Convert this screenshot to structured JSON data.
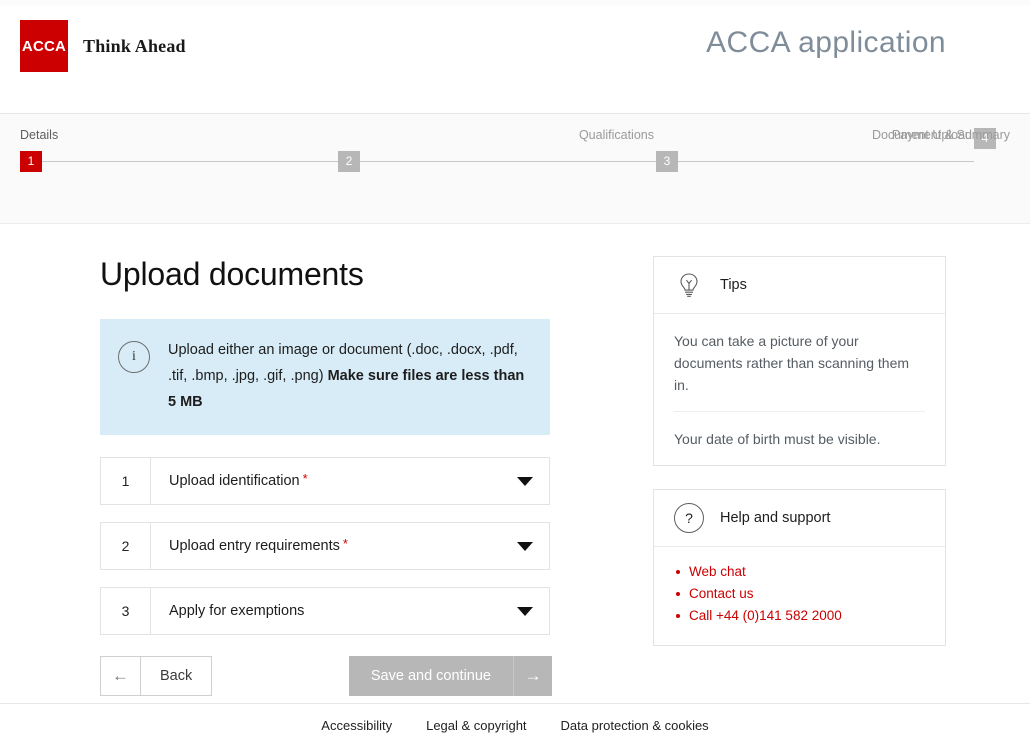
{
  "header": {
    "logo_text": "ACCA",
    "tagline": "Think Ahead",
    "app_title": "ACCA application",
    "brand_red": "#CC0000"
  },
  "stepper": {
    "steps": [
      {
        "number": "1",
        "label": "Details",
        "state": "active"
      },
      {
        "number": "2",
        "label": "Qualifications",
        "state": "inactive"
      },
      {
        "number": "3",
        "label": "Document Upload",
        "state": "inactive"
      },
      {
        "number": "4",
        "label": "Payment & Summary",
        "state": "inactive"
      }
    ]
  },
  "main": {
    "page_title": "Upload documents",
    "info_banner": {
      "icon": "info-icon",
      "text_normal": "Upload either an image or document (.doc, .docx, .pdf, .tif, .bmp, .jpg, .gif, .png) ",
      "text_bold": "Make sure files are less than 5 MB",
      "background": "#D7ECF7"
    },
    "accordion": [
      {
        "number": "1",
        "label": "Upload identification",
        "required": true,
        "required_marker": "*"
      },
      {
        "number": "2",
        "label": "Upload entry requirements",
        "required": true,
        "required_marker": "*"
      },
      {
        "number": "3",
        "label": "Apply for exemptions",
        "required": false,
        "required_marker": ""
      }
    ],
    "buttons": {
      "back_label": "Back",
      "back_arrow": "←",
      "save_label": "Save and continue",
      "save_arrow": "→",
      "save_disabled_color": "#B7B7B7"
    }
  },
  "sidebar": {
    "tips_panel": {
      "icon": "lightbulb-icon",
      "title": "Tips",
      "items": [
        "You can take a picture of your documents rather than scanning them in.",
        "Your date of birth must be visible."
      ]
    },
    "help_panel": {
      "icon": "question-mark-icon",
      "title": "Help and support",
      "links": [
        "Web chat",
        "Contact us",
        "Call +44 (0)141 582 2000"
      ],
      "link_color": "#CC0000"
    }
  },
  "footer": {
    "links": [
      "Accessibility",
      "Legal & copyright",
      "Data protection & cookies"
    ]
  }
}
